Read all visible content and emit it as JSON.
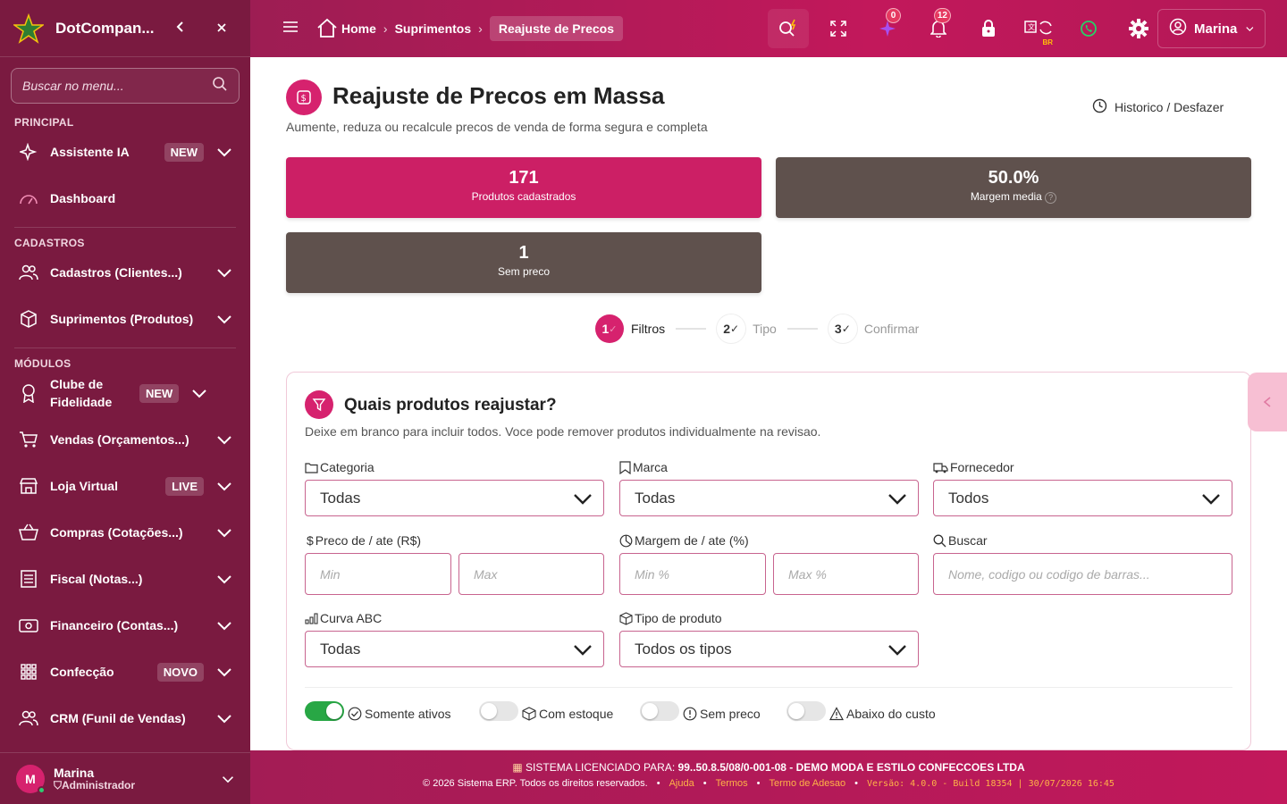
{
  "sidebar": {
    "brand": "DotCompan...",
    "search_placeholder": "Buscar no menu...",
    "sections": {
      "principal": "PRINCIPAL",
      "cadastros": "CADASTROS",
      "modulos": "MÓDULOS"
    },
    "items": [
      {
        "label": "Assistente IA",
        "badge": "NEW"
      },
      {
        "label": "Dashboard"
      },
      {
        "label": "Cadastros (Clientes...)"
      },
      {
        "label": "Suprimentos (Produtos)"
      },
      {
        "label": "Clube de Fidelidade",
        "badge": "NEW"
      },
      {
        "label": "Vendas (Orçamentos...)"
      },
      {
        "label": "Loja Virtual",
        "badge": "LIVE"
      },
      {
        "label": "Compras (Cotações...)"
      },
      {
        "label": "Fiscal (Notas...)"
      },
      {
        "label": "Financeiro (Contas...)"
      },
      {
        "label": "Confecção",
        "badge": "NOVO"
      },
      {
        "label": "CRM (Funil de Vendas)"
      }
    ],
    "user": {
      "initial": "M",
      "name": "Marina",
      "role": "Administrador"
    }
  },
  "header": {
    "breadcrumbs": [
      "Home",
      "Suprimentos",
      "Reajuste de Precos"
    ],
    "ai_count": "0",
    "notif_count": "12",
    "lang_code": "BR",
    "user_name": "Marina"
  },
  "page": {
    "title": "Reajuste de Precos em Massa",
    "subtitle": "Aumente, reduza ou recalcule precos de venda de forma segura e completa",
    "history_label": "Historico / Desfazer"
  },
  "stats": [
    {
      "value": "171",
      "caption": "Produtos cadastrados"
    },
    {
      "value": "50.0%",
      "caption": "Margem media"
    },
    {
      "value": "1",
      "caption": "Sem preco"
    }
  ],
  "steps": [
    {
      "num": "1",
      "label": "Filtros"
    },
    {
      "num": "2",
      "label": "Tipo"
    },
    {
      "num": "3",
      "label": "Confirmar"
    }
  ],
  "filters": {
    "title": "Quais produtos reajustar?",
    "subtitle": "Deixe em branco para incluir todos. Voce pode remover produtos individualmente na revisao.",
    "categoria": {
      "label": "Categoria",
      "value": "Todas"
    },
    "marca": {
      "label": "Marca",
      "value": "Todas"
    },
    "fornecedor": {
      "label": "Fornecedor",
      "value": "Todos"
    },
    "preco": {
      "label": "Preco de / ate (R$)",
      "min_placeholder": "Min",
      "max_placeholder": "Max"
    },
    "margem": {
      "label": "Margem de / ate (%)",
      "min_placeholder": "Min %",
      "max_placeholder": "Max %"
    },
    "buscar": {
      "label": "Buscar",
      "placeholder": "Nome, codigo ou codigo de barras..."
    },
    "curva": {
      "label": "Curva ABC",
      "value": "Todas"
    },
    "tipo": {
      "label": "Tipo de produto",
      "value": "Todos os tipos"
    },
    "toggles": [
      {
        "label": "Somente ativos",
        "on": true
      },
      {
        "label": "Com estoque",
        "on": false
      },
      {
        "label": "Sem preco",
        "on": false
      },
      {
        "label": "Abaixo do custo",
        "on": false
      }
    ]
  },
  "footer": {
    "license_prefix": "SISTEMA LICENCIADO PARA:",
    "license_text": "99..50.8.5/08/0-001-08 - DEMO MODA E ESTILO CONFECCOES LTDA",
    "copyright": "© 2026 Sistema ERP. Todos os direitos reservados.",
    "links": [
      "Ajuda",
      "Termos",
      "Termo de Adesao"
    ],
    "version": "Versão: 4.0.0 - Build 18354 | 30/07/2026 16:45"
  },
  "colors": {
    "primary": "#c2185b",
    "sidebar": "#7a1a40",
    "stat_brown": "#5f514d",
    "success": "#28a745"
  }
}
